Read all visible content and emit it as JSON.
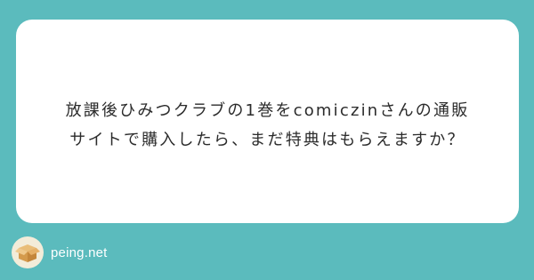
{
  "question": {
    "text": "放課後ひみつクラブの1巻をcomiczinさんの通販サイトで購入したら、まだ特典はもらえますか？"
  },
  "footer": {
    "site_name": "peing.net",
    "logo_icon": "box-icon"
  },
  "colors": {
    "background": "#5bbbbd",
    "card": "#ffffff",
    "text": "#2b2b2b",
    "logo_box": "#d9a45a"
  }
}
